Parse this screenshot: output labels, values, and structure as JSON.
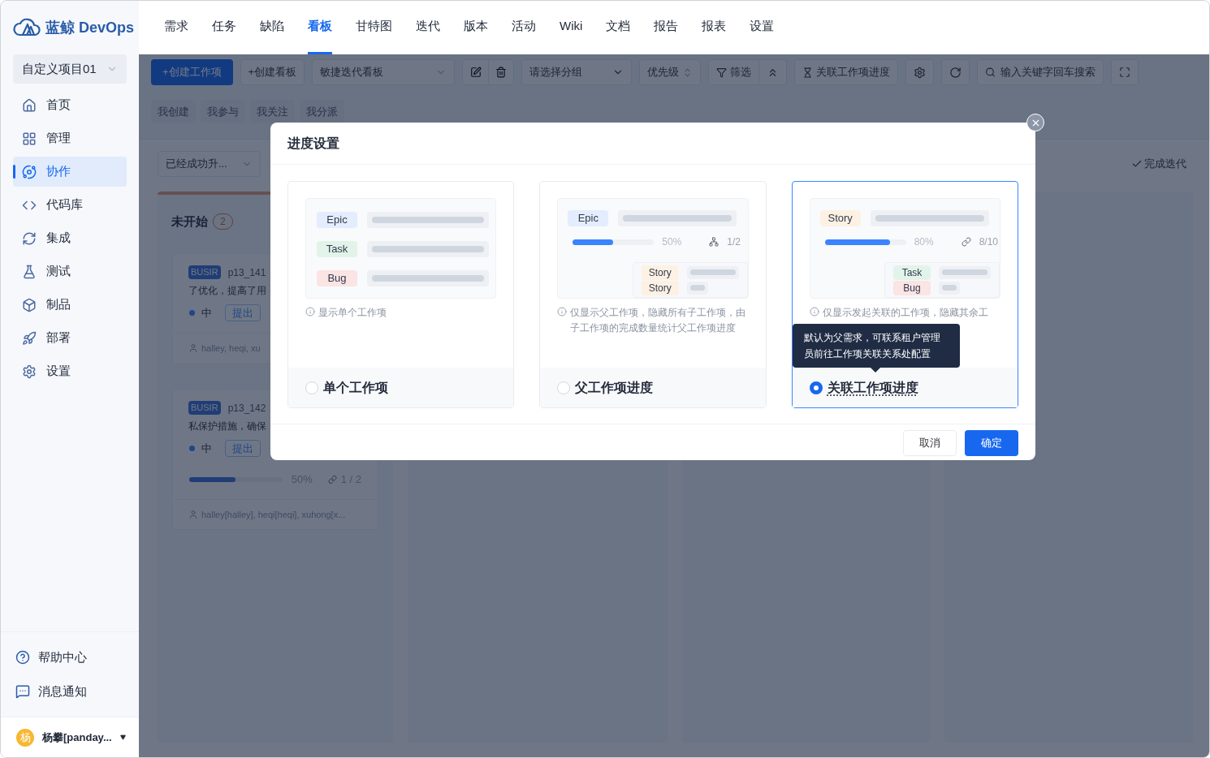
{
  "logo": {
    "brand": "蓝鲸",
    "product": "DevOps"
  },
  "project_selector": {
    "value": "自定义项目01"
  },
  "sidebar": {
    "items": [
      {
        "label": "首页",
        "selected": false
      },
      {
        "label": "管理",
        "selected": false
      },
      {
        "label": "协作",
        "selected": true
      },
      {
        "label": "代码库",
        "selected": false
      },
      {
        "label": "集成",
        "selected": false
      },
      {
        "label": "测试",
        "selected": false
      },
      {
        "label": "制品",
        "selected": false
      },
      {
        "label": "部署",
        "selected": false
      },
      {
        "label": "设置",
        "selected": false
      }
    ],
    "footer": [
      "帮助中心",
      "消息通知"
    ],
    "user": {
      "avatar": "杨",
      "name": "杨攀[panday..."
    }
  },
  "nav_tabs": [
    {
      "label": "需求",
      "selected": false
    },
    {
      "label": "任务",
      "selected": false
    },
    {
      "label": "缺陷",
      "selected": false
    },
    {
      "label": "看板",
      "selected": true
    },
    {
      "label": "甘特图",
      "selected": false
    },
    {
      "label": "迭代",
      "selected": false
    },
    {
      "label": "版本",
      "selected": false
    },
    {
      "label": "活动",
      "selected": false
    },
    {
      "label": "Wiki",
      "selected": false
    },
    {
      "label": "文档",
      "selected": false
    },
    {
      "label": "报告",
      "selected": false
    },
    {
      "label": "报表",
      "selected": false
    },
    {
      "label": "设置",
      "selected": false
    }
  ],
  "toolbar": {
    "create_item": "+创建工作项",
    "create_board": "+创建看板",
    "board_select": "敏捷迭代看板",
    "group_placeholder": "请选择分组",
    "priority": "优先级",
    "filter": "筛选",
    "progress": "关联工作项进度",
    "search_placeholder": "输入关键字回车搜索"
  },
  "quick_filters": [
    "我创建",
    "我参与",
    "我关注",
    "我分派"
  ],
  "sprint_select": "已经成功升...",
  "complete_sprint": "完成迭代",
  "column": {
    "title": "未开始",
    "count": "2"
  },
  "cards": [
    {
      "tag": "BUSIR",
      "id": "p13_141",
      "summary": "了优化，提高了用",
      "priority": "中",
      "status": "提出",
      "assignees": "halley, heqi, xu"
    },
    {
      "tag": "BUSIR",
      "id": "p13_142",
      "summary": "私保护措施，确保",
      "priority": "中",
      "status": "提出",
      "progress": {
        "level": 0.5,
        "percent": "50%",
        "count": "1 / 2"
      },
      "assignees": "halley[halley], heqi[heqi], xuhong[x..."
    }
  ],
  "dialog": {
    "title": "进度设置",
    "options": [
      {
        "kind": "single",
        "rows": [
          {
            "tag": "Epic",
            "color": "#e3edfd"
          },
          {
            "tag": "Task",
            "color": "#e2f4ea"
          },
          {
            "tag": "Bug",
            "color": "#fbe4e4"
          }
        ],
        "description": "显示单个工作项",
        "label": "单个工作项",
        "selected": false
      },
      {
        "kind": "parent",
        "parent": {
          "tag": "Epic",
          "color": "#e3edfd"
        },
        "level": 0.5,
        "percent": "50%",
        "count": "1/2",
        "children": [
          {
            "tag": "Story",
            "color": "#fdf1e3"
          },
          {
            "tag": "Story",
            "color": "#fdf1e3"
          }
        ],
        "description": "仅显示父工作项，隐藏所有子工作项，由子工作项的完成数量统计父工作项进度",
        "label": "父工作项进度",
        "selected": false
      },
      {
        "kind": "linked",
        "parent": {
          "tag": "Story",
          "color": "#fdf1e3"
        },
        "level": 0.8,
        "percent": "80%",
        "count": "8/10",
        "children": [
          {
            "tag": "Task",
            "color": "#e2f4ea"
          },
          {
            "tag": "Bug",
            "color": "#fbe4e4"
          }
        ],
        "description": "仅显示发起关联的工作项，隐藏其余工",
        "label": "关联工作项进度",
        "tooltip": "默认为父需求，可联系租户管理员前往工作项关联关系处配置",
        "selected": true
      }
    ],
    "cancel": "取消",
    "ok": "确定"
  }
}
